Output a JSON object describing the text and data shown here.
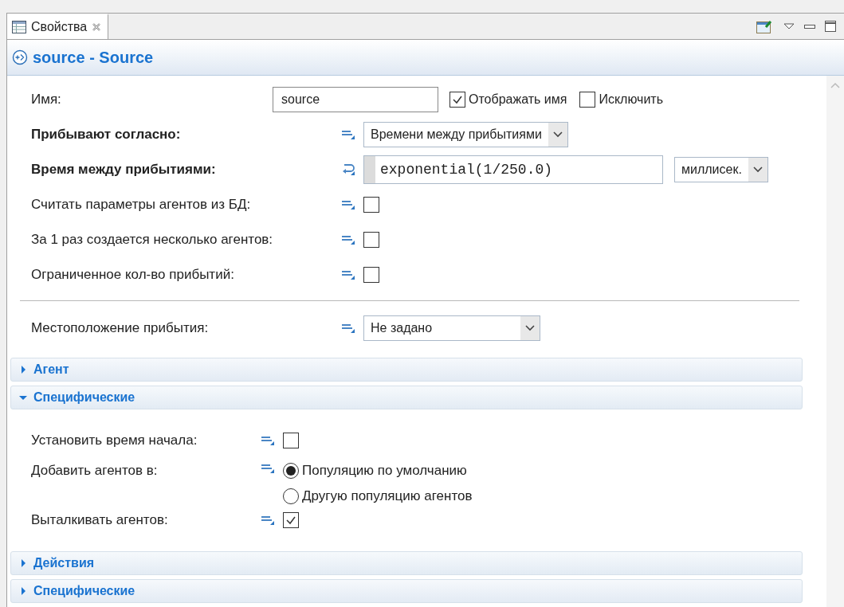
{
  "tab": {
    "label": "Свойства",
    "selected": true
  },
  "header": {
    "title": "source - Source"
  },
  "groups": [
    {
      "rows": [
        {
          "kind": "name",
          "label": "Имя:",
          "value": "source",
          "checks": [
            {
              "label": "Отображать имя",
              "checked": true
            },
            {
              "label": "Исключить",
              "checked": false
            }
          ]
        },
        {
          "kind": "dropdown",
          "label": "Прибывают согласно:",
          "bold": true,
          "value": "Времени между прибытиями"
        },
        {
          "kind": "code",
          "label": "Время между прибытиями:",
          "bold": true,
          "value": "exponential(1/250.0)",
          "unit": "миллисек."
        },
        {
          "kind": "checkbox",
          "label": "Считать параметры агентов из БД:",
          "bold": false,
          "checked": false
        },
        {
          "kind": "checkbox",
          "label": "За 1 раз создается несколько агентов:",
          "bold": false,
          "checked": false
        },
        {
          "kind": "checkbox",
          "label": "Ограниченное кол-во прибытий:",
          "bold": false,
          "checked": false
        }
      ]
    },
    {
      "rows": [
        {
          "kind": "dropdown",
          "label": "Местоположение прибытия:",
          "bold": false,
          "value": "Не задано"
        }
      ]
    }
  ],
  "sections": [
    {
      "title": "Агент",
      "expanded": false
    },
    {
      "title": "Специфические",
      "expanded": true,
      "rows": [
        {
          "kind": "checkbox",
          "label": "Установить время начала:",
          "bold": false,
          "checked": false
        },
        {
          "kind": "radio",
          "label": "Добавить агентов в:",
          "bold": false,
          "options": [
            {
              "label": "Популяцию по умолчанию",
              "selected": true
            },
            {
              "label": "Другую популяцию агентов",
              "selected": false
            }
          ]
        },
        {
          "kind": "checkbox",
          "label": "Выталкивать агентов:",
          "bold": false,
          "checked": true
        }
      ]
    },
    {
      "title": "Действия",
      "expanded": false
    },
    {
      "title": "Специфические",
      "expanded": false
    }
  ]
}
